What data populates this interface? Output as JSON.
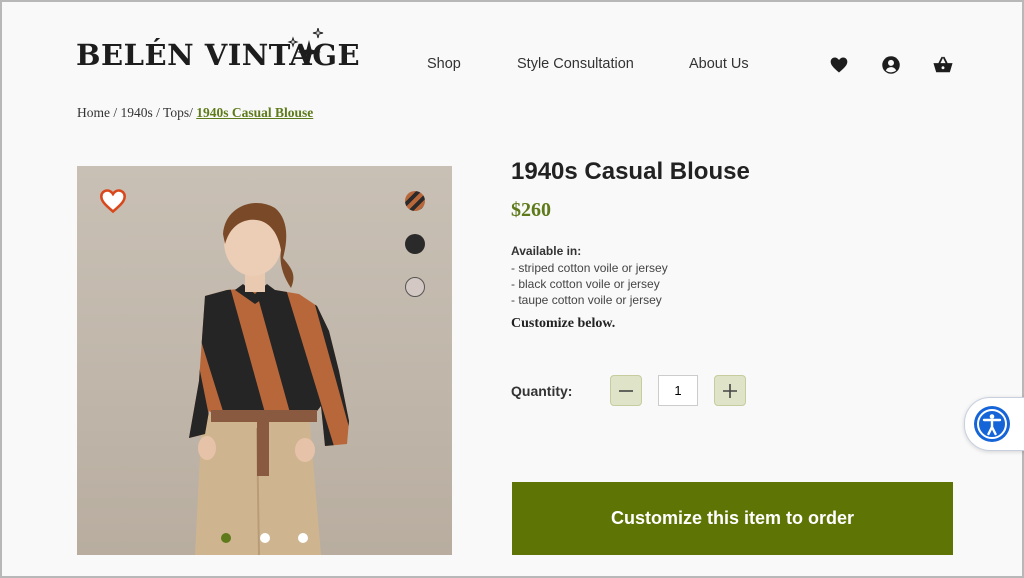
{
  "brand": {
    "name": "BELÉN VINTAGE"
  },
  "nav": {
    "items": [
      {
        "label": "Shop"
      },
      {
        "label": "Style Consultation"
      },
      {
        "label": "About Us"
      }
    ]
  },
  "header_icons": [
    "heart-icon",
    "user-account-icon",
    "cart-basket-icon"
  ],
  "breadcrumb": {
    "home": "Home",
    "decade": "1940s",
    "category": "Tops/",
    "current": "1940s Casual Blouse"
  },
  "product": {
    "title": "1940s Casual Blouse",
    "price": "$260",
    "available_heading": "Available in:",
    "options": [
      "- striped cotton voile or jersey",
      "- black cotton voile or jersey",
      "- taupe cotton voile or jersey"
    ],
    "customize_note": "Customize below.",
    "swatches": [
      "striped",
      "black",
      "taupe"
    ],
    "carousel": {
      "slides": 3,
      "active": 1
    }
  },
  "quantity": {
    "label": "Quantity:",
    "value": "1"
  },
  "cta": {
    "label": "Customize this item to order"
  },
  "colors": {
    "accent": "#5e7506",
    "link": "#5e7a1a",
    "qty_button": "#dfe4c8",
    "swatch_black": "#2a2a2a",
    "swatch_taupe": "#d3c8c3",
    "stripe_rust": "#b8673a",
    "a11y_blue": "#1565d8"
  }
}
